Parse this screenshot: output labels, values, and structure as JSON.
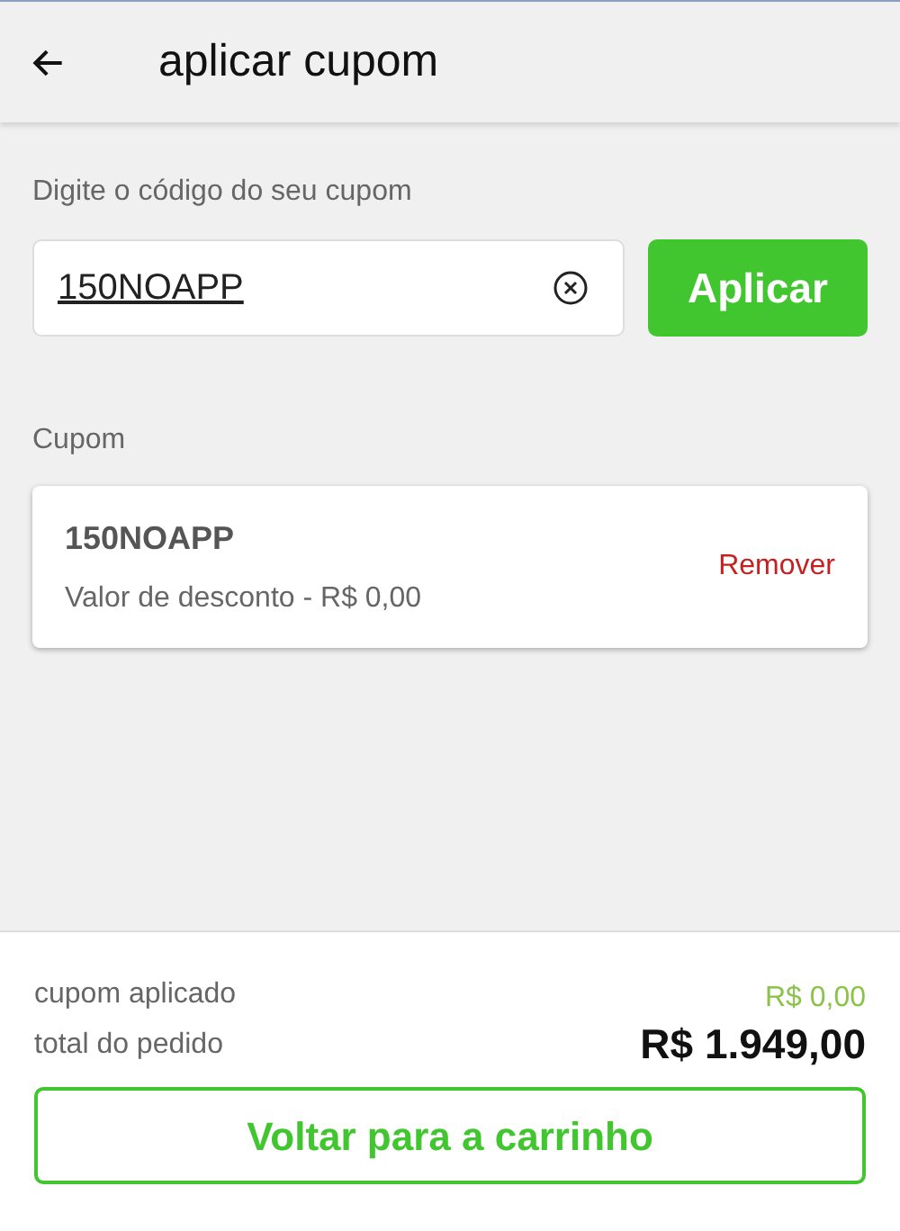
{
  "header": {
    "title": "aplicar cupom"
  },
  "coupon_input": {
    "label": "Digite o código do seu cupom",
    "value": "150NOAPP",
    "apply_button": "Aplicar"
  },
  "applied": {
    "heading": "Cupom",
    "coupons": [
      {
        "code": "150NOAPP",
        "discount": "Valor de desconto - R$ 0,00",
        "remove": "Remover"
      }
    ]
  },
  "summary": {
    "rows": [
      {
        "kind": "discount",
        "label": "cupom aplicado",
        "value": "R$ 0,00"
      },
      {
        "kind": "total",
        "label": "total do pedido",
        "value": "R$ 1.949,00"
      }
    ],
    "back_button": "Voltar para a carrinho"
  }
}
